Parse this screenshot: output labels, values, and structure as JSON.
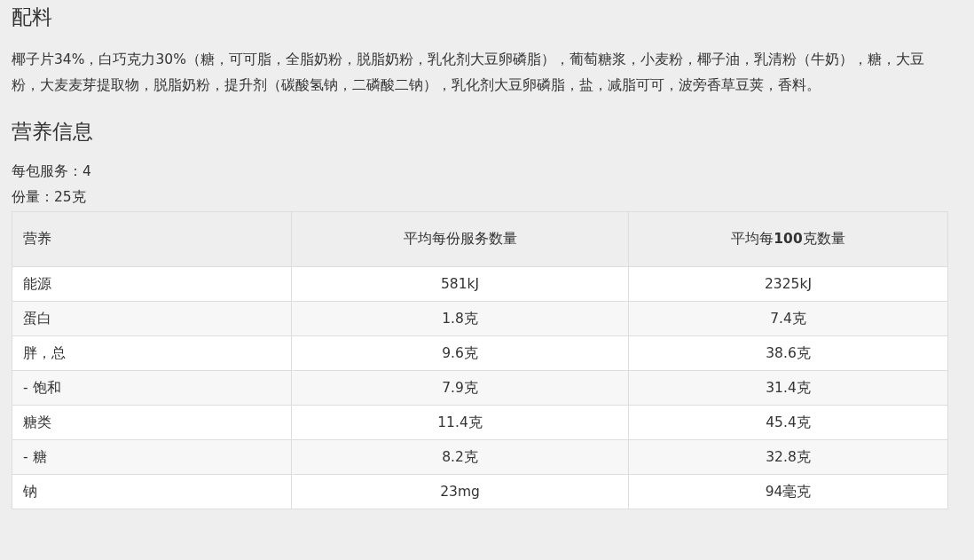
{
  "ingredients": {
    "heading": "配料",
    "text": "椰子片34%，白巧克力30%（糖，可可脂，全脂奶粉，脱脂奶粉，乳化剂大豆卵磷脂），葡萄糖浆，小麦粉，椰子油，乳清粉（牛奶），糖，大豆粉，大麦麦芽提取物，脱脂奶粉，提升剂（碳酸氢钠，二磷酸二钠），乳化剂大豆卵磷脂，盐，减脂可可，波旁香草豆荚，香料。"
  },
  "nutrition": {
    "heading": "营养信息",
    "servings": "每包服务：4",
    "serving_size": "份量：25克",
    "table": {
      "columns": [
        "营养",
        "平均每份服务数量",
        "平均每**100**克数量"
      ],
      "rows": [
        [
          "能源",
          "581kJ",
          "2325kJ"
        ],
        [
          "蛋白",
          "1.8克",
          "7.4克"
        ],
        [
          "胖，总",
          "9.6克",
          "38.6克"
        ],
        [
          "- 饱和",
          "7.9克",
          "31.4克"
        ],
        [
          "糖类",
          "11.4克",
          "45.4克"
        ],
        [
          "- 糖",
          "8.2克",
          "32.8克"
        ],
        [
          "钠",
          "23mg",
          "94毫克"
        ]
      ]
    }
  }
}
